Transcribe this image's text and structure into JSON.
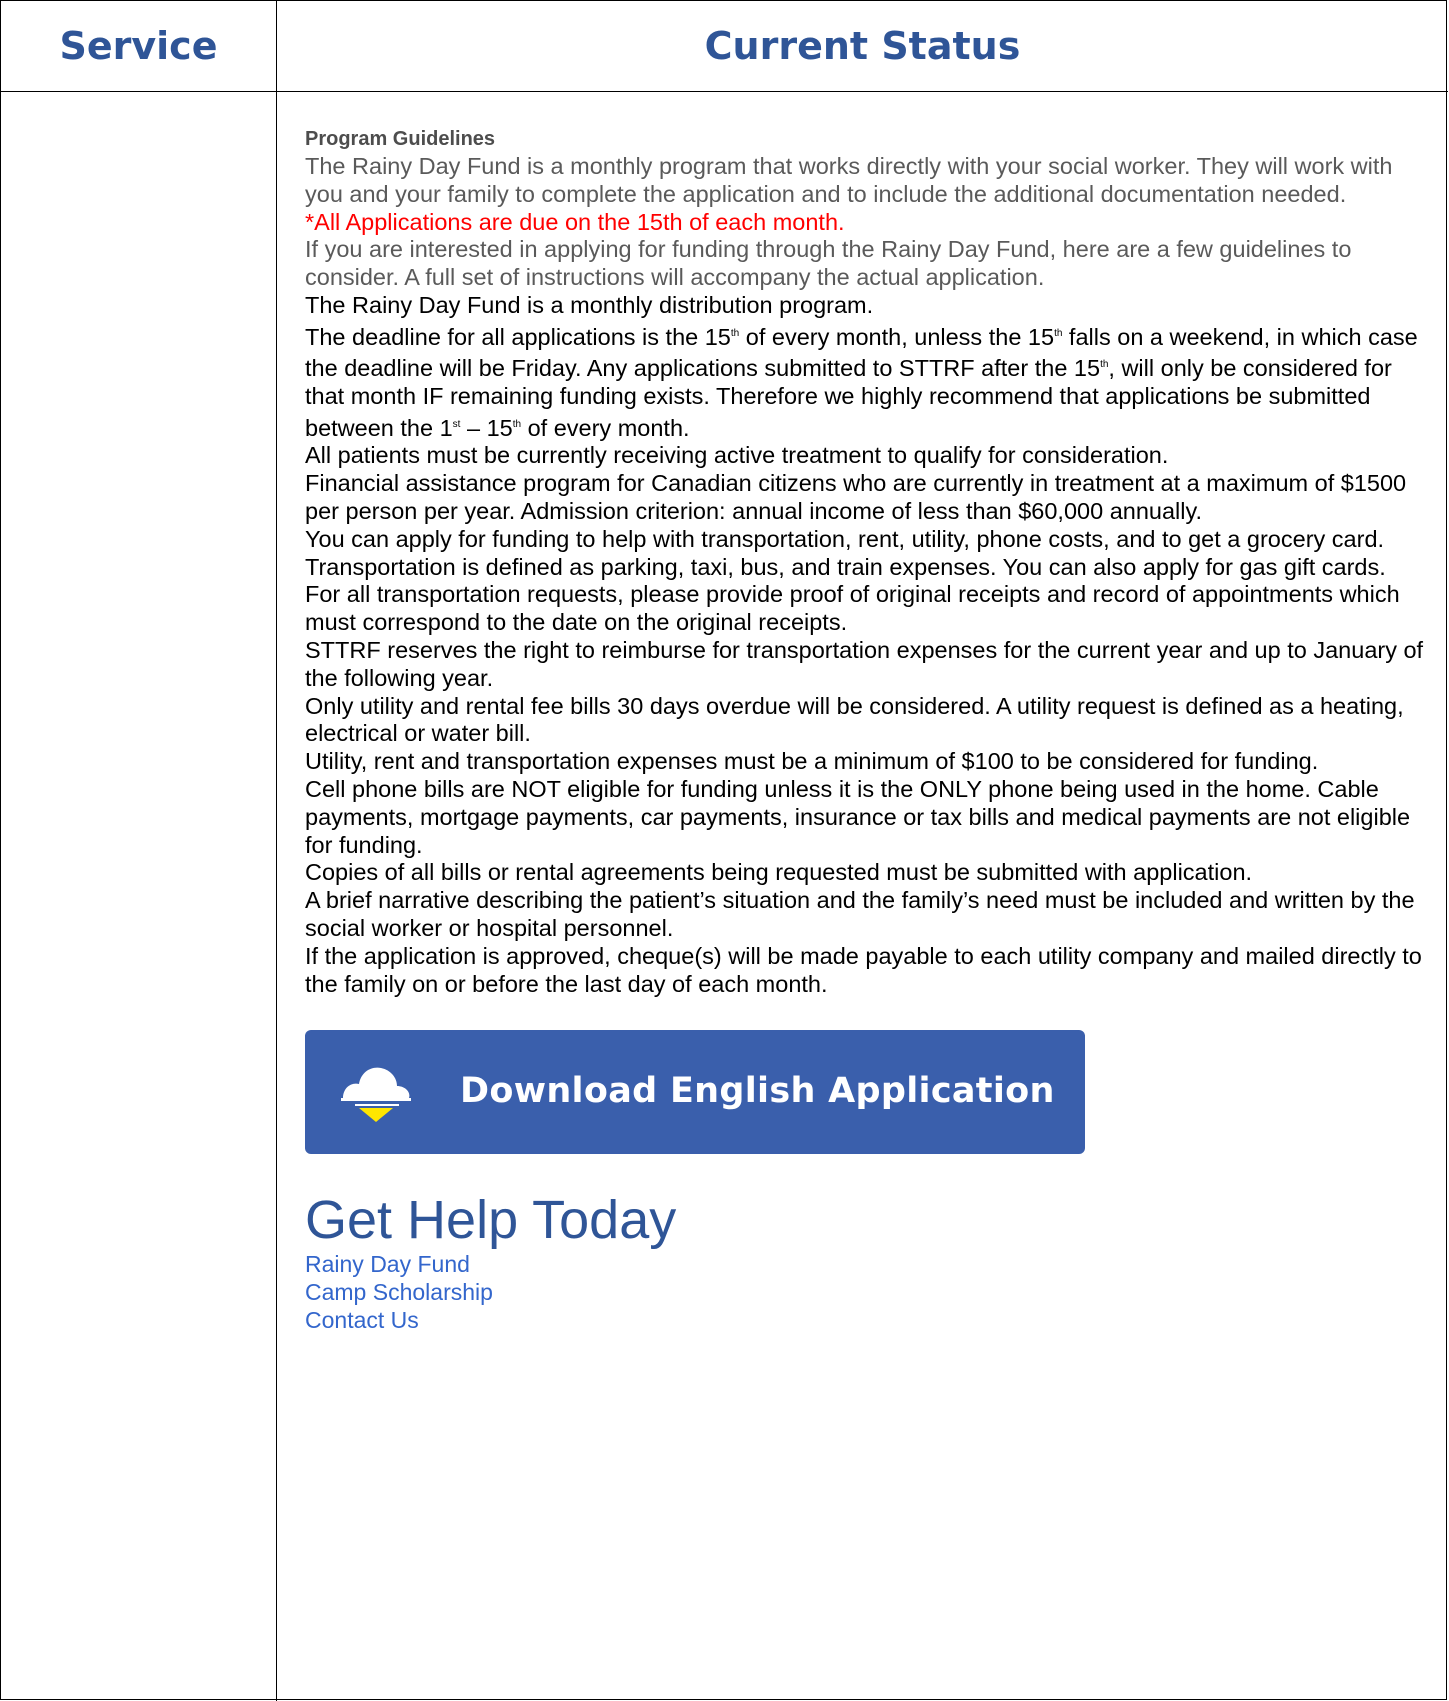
{
  "table": {
    "header_service": "Service",
    "header_status": "Current Status"
  },
  "guidelines": {
    "title": "Program Guidelines",
    "intro": "The Rainy Day Fund is a monthly program that works directly with your social worker. They will work with you and your family to complete the application and to include the additional documentation needed.",
    "deadline_notice": "*All Applications are due on the 15th of each month.",
    "interest": "If you are interested in applying for funding through the Rainy Day Fund, here are a few guidelines to consider. A full set of instructions will accompany the actual application.",
    "distribution": "The Rainy Day Fund is a monthly distribution program.",
    "deadline": {
      "p1": "The deadline for all applications is the 15",
      "sup1": "th",
      "p2": " of every month, unless the 15",
      "sup2": "th",
      "p3": " falls on a weekend, in which case the deadline will be Friday. Any applications submitted to STTRF after the 15",
      "sup3": "th",
      "p4": ", will only be considered for that month IF remaining funding exists. Therefore we highly recommend that applications be submitted between the 1",
      "sup4": "st",
      "p5": " – 15",
      "sup5": "th",
      "p6": " of every month."
    },
    "active_treatment": "All patients must be currently receiving active treatment to qualify for consideration.",
    "financial": "Financial assistance program for Canadian citizens who are currently in treatment at a maximum of $1500 per person per year. Admission criterion: annual income of less than $60,000 annually.",
    "apply_for": "You can apply for funding to help with transportation, rent, utility, phone costs, and to get a grocery card.",
    "transportation": "Transportation is defined as parking, taxi, bus, and train expenses. You can also apply for gas gift cards. For all transportation requests, please provide proof of original receipts and record of appointments which must correspond to the date on the original receipts.",
    "reimburse": "STTRF reserves the right to reimburse for transportation expenses for the current year and up to January of the following year.",
    "utility_overdue": "Only utility and rental fee bills 30 days overdue will be considered. A utility request is defined as a heating, electrical or water bill.",
    "minimum": "Utility, rent and transportation expenses must be a minimum of $100 to be considered for funding.",
    "cell_phone": "Cell phone bills are NOT eligible for funding unless it is the ONLY phone being used in the home. Cable payments, mortgage payments, car payments, insurance or tax bills and medical payments are not eligible for funding.",
    "copies": "Copies of all bills or rental agreements being requested must be submitted with application.",
    "narrative": "A brief narrative describing the patient’s situation and the family’s need must be included and written by the social worker or hospital personnel.",
    "approved": "If the application is approved, cheque(s) will be made payable to each utility company and mailed directly to the family on or before the last day of each month."
  },
  "download_button": {
    "label": "Download English Application",
    "icon": "cloud-download-icon"
  },
  "help": {
    "title": "Get Help Today",
    "links": [
      "Rainy Day Fund",
      "Camp Scholarship",
      "Contact Us"
    ]
  },
  "colors": {
    "header_text": "#2f5597",
    "button_bg": "#3a5fac",
    "notice_red": "#ff0000",
    "link": "#3366cc",
    "arrow_yellow": "#ffe600"
  }
}
